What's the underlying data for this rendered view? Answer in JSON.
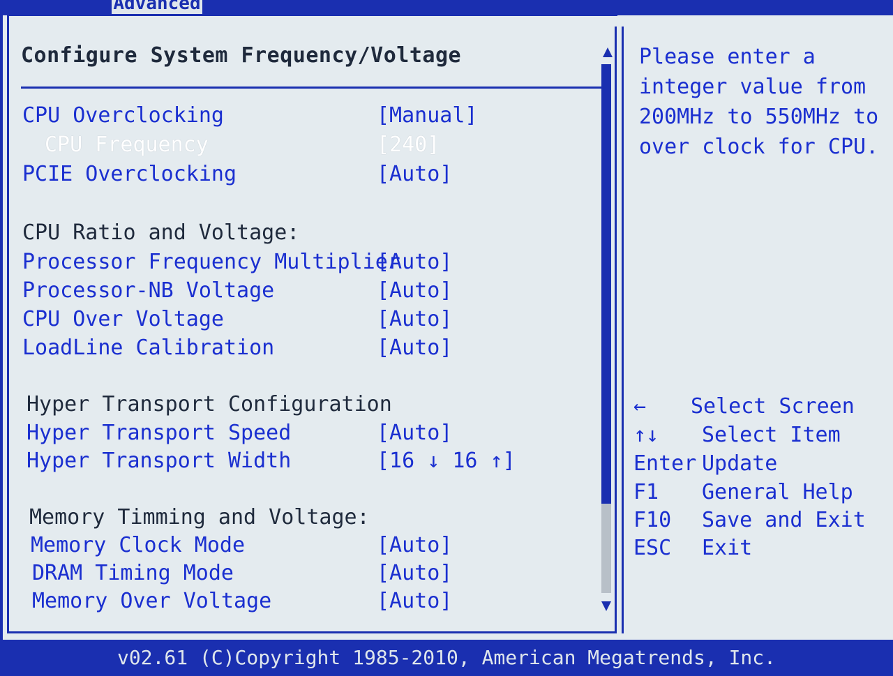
{
  "tabs": {
    "active_label": "Advanced"
  },
  "main": {
    "title": "Configure System Frequency/Voltage",
    "items": [
      {
        "label": "CPU Overclocking",
        "value": "[Manual]"
      },
      {
        "label": "CPU Frequency",
        "value": "[240]"
      },
      {
        "label": "PCIE Overclocking",
        "value": "[Auto]"
      }
    ],
    "sections": [
      {
        "heading": "CPU Ratio and Voltage:",
        "items": [
          {
            "label": "Processor Frequency Multiplier",
            "value": "[Auto]"
          },
          {
            "label": "Processor-NB Voltage",
            "value": "[Auto]"
          },
          {
            "label": "CPU Over Voltage",
            "value": "[Auto]"
          },
          {
            "label": "LoadLine Calibration",
            "value": "[Auto]"
          }
        ]
      },
      {
        "heading": "Hyper Transport Configuration",
        "items": [
          {
            "label": "Hyper Transport Speed",
            "value": "[Auto]"
          },
          {
            "label": "Hyper Transport Width",
            "value": "[16 ↓ 16 ↑]"
          }
        ]
      },
      {
        "heading": "Memory Timming and Voltage:",
        "items": [
          {
            "label": "Memory Clock Mode",
            "value": "[Auto]"
          },
          {
            "label": "DRAM Timing Mode",
            "value": "[Auto]"
          },
          {
            "label": "Memory Over Voltage",
            "value": "[Auto]"
          }
        ]
      }
    ]
  },
  "help": {
    "text": "Please enter a integer value from 200MHz to 550MHz to over clock for CPU."
  },
  "keys": [
    {
      "key": "←",
      "desc": "Select Screen"
    },
    {
      "key": "↑↓",
      "desc": "Select Item"
    },
    {
      "key": "Enter",
      "desc": "Update"
    },
    {
      "key": "F1",
      "desc": "General Help"
    },
    {
      "key": "F10",
      "desc": "Save and Exit"
    },
    {
      "key": "ESC",
      "desc": "Exit"
    }
  ],
  "footer": {
    "copyright": "v02.61 (C)Copyright 1985-2010, American Megatrends, Inc."
  },
  "colors": {
    "background": "#e4ebef",
    "accent": "#1a2fb0",
    "item_text": "#1a2fd0",
    "heading_text": "#1f2a3c"
  }
}
